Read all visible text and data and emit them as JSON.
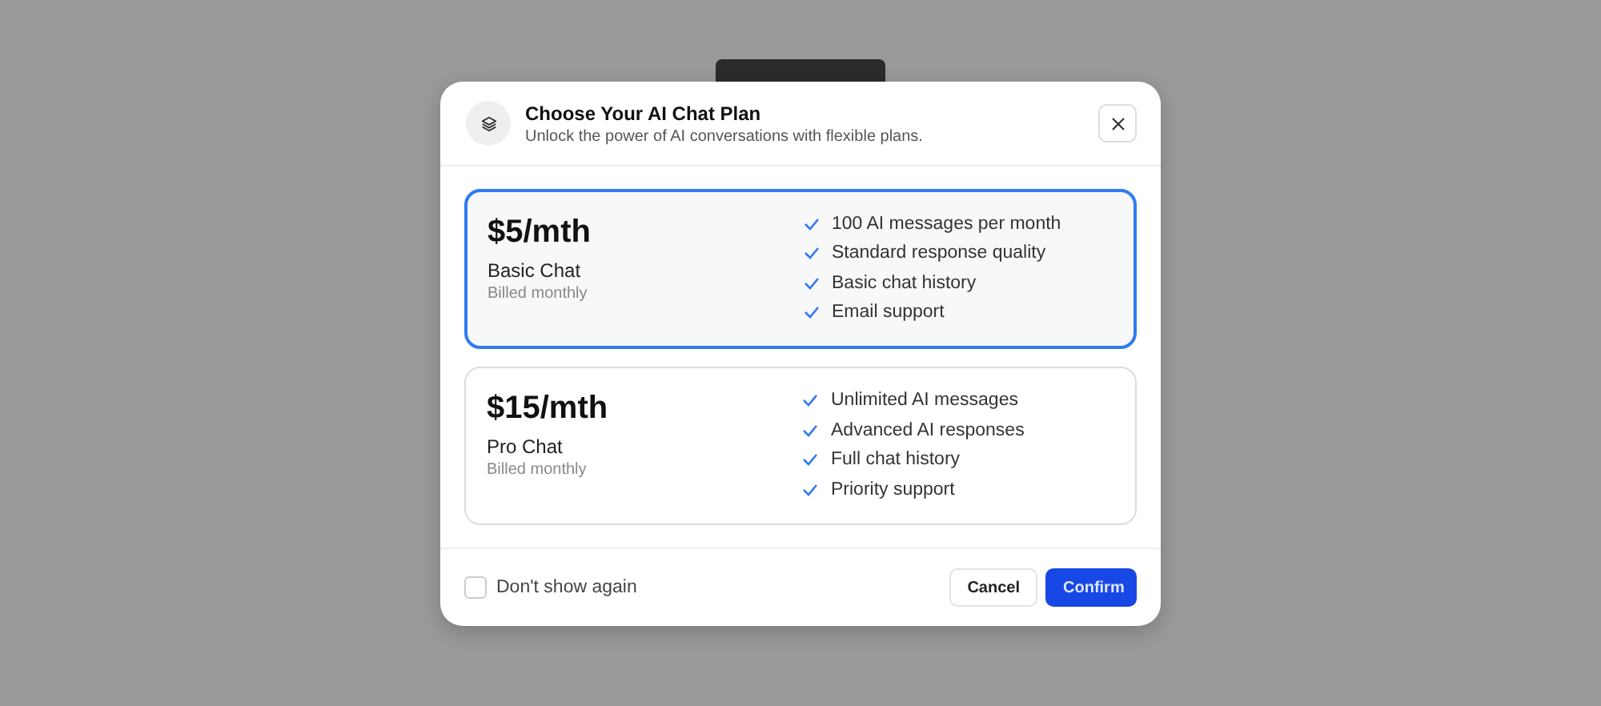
{
  "dialog": {
    "title": "Choose Your AI Chat Plan",
    "subtitle": "Unlock the power of AI conversations with flexible plans.",
    "plans": [
      {
        "price": "$5/mth",
        "name": "Basic Chat",
        "billing": "Billed monthly",
        "selected": true,
        "features": [
          "100 AI messages per month",
          "Standard response quality",
          "Basic chat history",
          "Email support"
        ]
      },
      {
        "price": "$15/mth",
        "name": "Pro Chat",
        "billing": "Billed monthly",
        "selected": false,
        "features": [
          "Unlimited AI messages",
          "Advanced AI responses",
          "Full chat history",
          "Priority support"
        ]
      }
    ],
    "dont_show_again": {
      "label": "Don't show again",
      "checked": false
    },
    "buttons": [
      {
        "label": "Cancel",
        "kind": "secondary"
      },
      {
        "label": "Confirm",
        "kind": "primary"
      }
    ]
  }
}
